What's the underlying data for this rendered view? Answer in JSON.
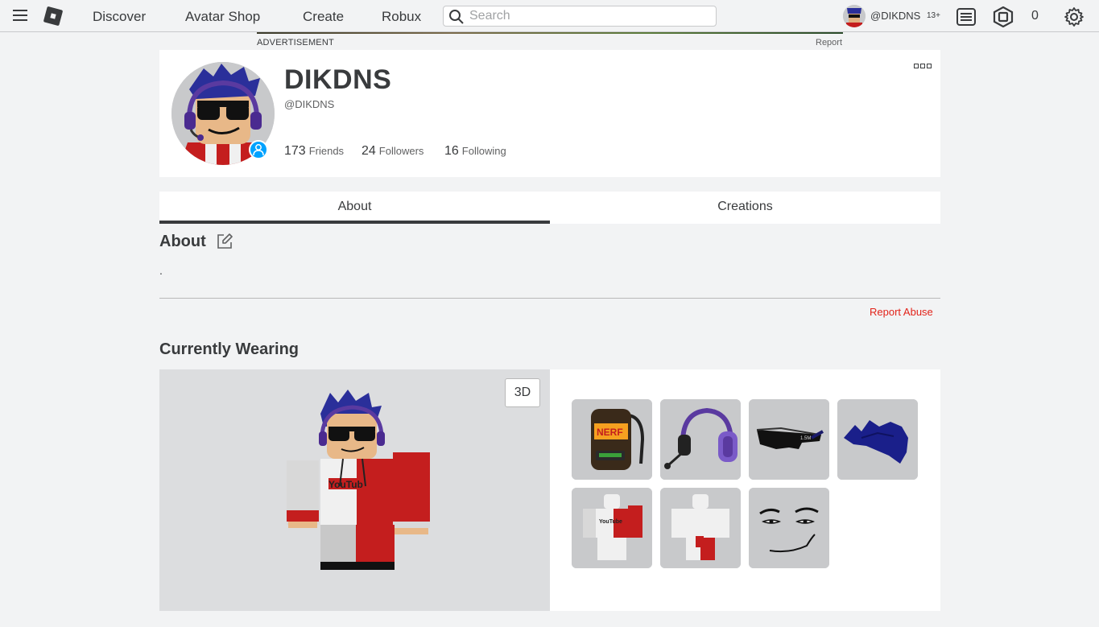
{
  "nav": {
    "links": [
      "Discover",
      "Avatar Shop",
      "Create",
      "Robux"
    ],
    "search_placeholder": "Search",
    "username": "@DIKDNS",
    "age_badge": "13+",
    "robux_count": "0"
  },
  "ad": {
    "label": "ADVERTISEMENT",
    "report": "Report"
  },
  "profile": {
    "display_name": "DIKDNS",
    "username": "@DIKDNS",
    "friends_count": "173",
    "friends_label": "Friends",
    "followers_count": "24",
    "followers_label": "Followers",
    "following_count": "16",
    "following_label": "Following"
  },
  "tabs": [
    "About",
    "Creations"
  ],
  "about": {
    "title": "About",
    "text": ".",
    "report_abuse": "Report Abuse"
  },
  "wearing": {
    "title": "Currently Wearing",
    "view_toggle": "3D",
    "items": [
      {
        "name": "nerf-backpack",
        "icon": "backpack-icon"
      },
      {
        "name": "purple-headset",
        "icon": "headset-icon"
      },
      {
        "name": "black-sunglasses",
        "icon": "sunglasses-icon"
      },
      {
        "name": "blue-hair",
        "icon": "hair-icon"
      },
      {
        "name": "youtube-shirt",
        "icon": "shirt-icon"
      },
      {
        "name": "white-pants",
        "icon": "pants-icon"
      },
      {
        "name": "man-face",
        "icon": "face-icon"
      }
    ]
  },
  "colors": {
    "accent_blue": "#00a2ff",
    "report_red": "#e2231a",
    "text_dark": "#393b3d",
    "bg": "#f2f3f4"
  }
}
